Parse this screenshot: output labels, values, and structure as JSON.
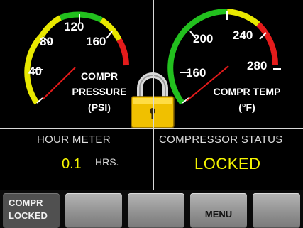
{
  "pressure_gauge": {
    "ticks": [
      "40",
      "80",
      "120",
      "160"
    ],
    "label_lines": [
      "COMPR",
      "PRESSURE",
      "(PSI)"
    ]
  },
  "temp_gauge": {
    "ticks": [
      "160",
      "200",
      "240",
      "280"
    ],
    "label_lines": [
      "COMPR TEMP",
      "(°F)"
    ]
  },
  "hour_meter": {
    "label": "HOUR METER",
    "value": "0.1",
    "unit": "HRS."
  },
  "compressor_status": {
    "label": "COMPRESSOR STATUS",
    "value": "LOCKED"
  },
  "softkeys": [
    {
      "label_lines": [
        "COMPR",
        "LOCKED"
      ]
    },
    {
      "label_lines": []
    },
    {
      "label_lines": []
    },
    {
      "label_lines": [
        "MENU"
      ]
    },
    {
      "label_lines": []
    }
  ],
  "colors": {
    "green": "#22c01e",
    "yellow": "#e8e800",
    "red": "#e41b1b",
    "needle": "#e21a1a",
    "value_text": "#f5f500",
    "lock_body": "#f0c000"
  },
  "icons": [
    "padlock-icon"
  ]
}
